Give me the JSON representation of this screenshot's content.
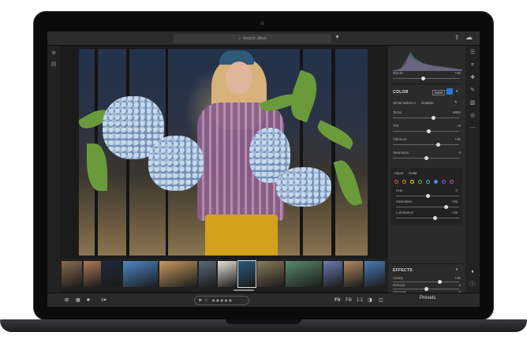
{
  "app": {
    "search_placeholder": "Search Jillian"
  },
  "icons": {
    "search": "search-icon",
    "filter": "filter-icon",
    "share": "share-icon",
    "cloud": "cloud-icon",
    "add": "add-photos-icon",
    "library": "library-icon",
    "grid": "grid-view-icon",
    "square_grid": "square-grid-icon",
    "single": "single-view-icon",
    "sort": "sort-icon",
    "edit": "edit-sliders-icon",
    "crop": "crop-icon",
    "healing": "healing-brush-icon",
    "brush": "brush-icon",
    "gradient": "linear-gradient-icon",
    "radial": "radial-gradient-icon",
    "more": "more-icon",
    "tag": "keywords-icon",
    "info": "info-icon"
  },
  "panel": {
    "top_slider_label": "Blacks",
    "top_slider_value": "+40",
    "color_section": {
      "title": "COLOR",
      "bw_label": "B&W",
      "white_balance_label": "White Balance",
      "white_balance_value": "Custom",
      "sliders": [
        {
          "label": "Temp",
          "value": "6950",
          "level": 0.62
        },
        {
          "label": "Tint",
          "value": "+9",
          "level": 0.55
        },
        {
          "label": "Vibrance",
          "value": "+40",
          "level": 0.7
        },
        {
          "label": "Saturation",
          "value": "0",
          "level": 0.5
        }
      ]
    },
    "mixer": {
      "adjust_label": "Adjust",
      "adjust_value": "Color",
      "swatches": [
        "#d9534f",
        "#e08a2c",
        "#e6d23a",
        "#5fb84d",
        "#3fb7b0",
        "#4a8cf0",
        "#8a5fd6",
        "#c257b8"
      ],
      "selected_index": 5,
      "sliders": [
        {
          "label": "Hue",
          "value": "0",
          "level": 0.5
        },
        {
          "label": "Saturation",
          "value": "+65",
          "level": 0.82
        },
        {
          "label": "Luminance",
          "value": "+25",
          "level": 0.62
        }
      ]
    },
    "effects": {
      "title": "EFFECTS",
      "sliders": [
        {
          "label": "Clarity",
          "value": "+45",
          "level": 0.72
        },
        {
          "label": "Dehaze",
          "value": "0",
          "level": 0.5
        },
        {
          "label": "Vignette",
          "value": "0",
          "level": 0.5
        }
      ]
    }
  },
  "bottombar": {
    "zoom_fit": "Fit",
    "zoom_fill": "Fill",
    "zoom_1to1": "1:1",
    "presets_label": "Presets",
    "rating_stars": "★★★★★"
  },
  "filmstrip": {
    "thumb_colors": [
      "#8a6a50",
      "#b07a58",
      "#1e2a3a",
      "#4c89c8",
      "#c89a60",
      "#5a6a7a",
      "#e8e0d8",
      "#2d5a7a",
      "#8a7a5a",
      "#5a8a6a",
      "#6a7ab0",
      "#b08a60",
      "#4a7ab8",
      "#d0d8e0"
    ],
    "selected_index": 7
  }
}
